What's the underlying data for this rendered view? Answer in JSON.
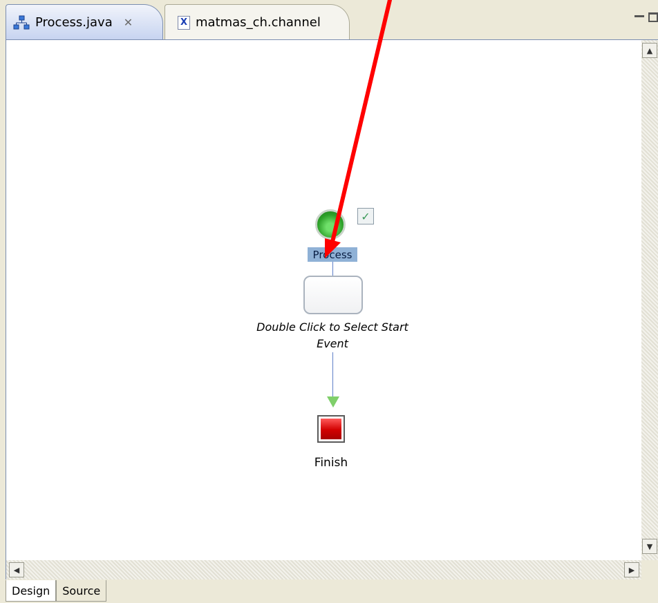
{
  "tabs": [
    {
      "label": "Process.java",
      "icon": "process-diagram-icon",
      "active": true,
      "close_glyph": "✕"
    },
    {
      "label": "matmas_ch.channel",
      "icon": "x-file-icon",
      "icon_text": "X",
      "active": false
    }
  ],
  "diagram": {
    "start_node_label": "Process",
    "placeholder_text": "Double Click to Select Start Event",
    "end_node_label": "Finish"
  },
  "bottom_tabs": [
    {
      "label": "Design",
      "active": true
    },
    {
      "label": "Source",
      "active": false
    }
  ],
  "colors": {
    "annotation_arrow": "#ff0000",
    "start_node": "#2ea12a",
    "end_node": "#d10000",
    "selection": "#8fb1d6",
    "connector": "#5f7fc8"
  }
}
